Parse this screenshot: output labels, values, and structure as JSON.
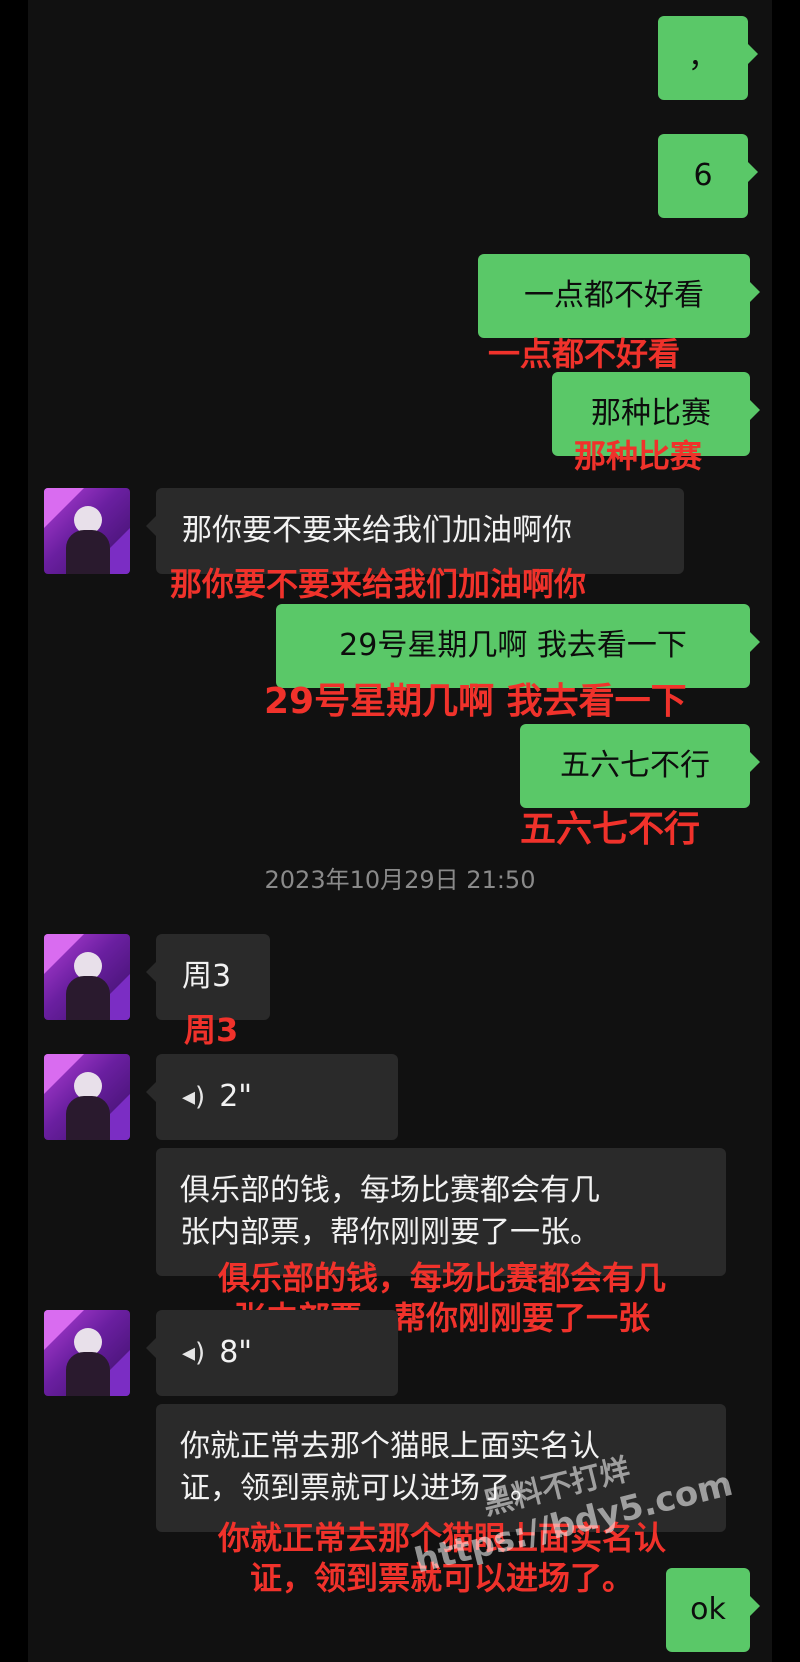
{
  "chat": {
    "sent_comma": "，",
    "sent_six": "6",
    "sent_1": "一点都不好看",
    "caption_1": "一点都不好看",
    "sent_2": "那种比赛",
    "caption_2": "那种比赛",
    "recv_1": "那你要不要来给我们加油啊你",
    "caption_3": "那你要不要来给我们加油啊你",
    "sent_3": "29号星期几啊 我去看一下",
    "caption_4": "29号星期几啊 我去看一下",
    "sent_4": "五六七不行",
    "caption_5": "五六七不行",
    "timestamp": "2023年10月29日 21:50",
    "recv_2": "周3",
    "caption_6": "周3",
    "voice_1_duration": "2\"",
    "recv_3": "俱乐部的钱，每场比赛都会有几\n张内部票，帮你刚刚要了一张。",
    "caption_7": "俱乐部的钱，每场比赛都会有几\n张内部票，帮你刚刚要了一张",
    "voice_2_duration": "8\"",
    "recv_4": "你就正常去那个猫眼上面实名认\n证，领到票就可以进场了。",
    "caption_8": "你就正常去那个猫眼上面实名认\n证，领到票就可以进场了。",
    "sent_ok": "ok"
  },
  "watermark": {
    "line1": "黑料不打烊",
    "line2": "https://bdy5.com"
  },
  "icons": {
    "voice": "voice-wave-icon",
    "avatar": "contact-avatar"
  },
  "colors": {
    "sent_bubble": "#5ac868",
    "recv_bubble": "#2a2a2a",
    "caption": "#f0322b",
    "background": "#111111"
  }
}
